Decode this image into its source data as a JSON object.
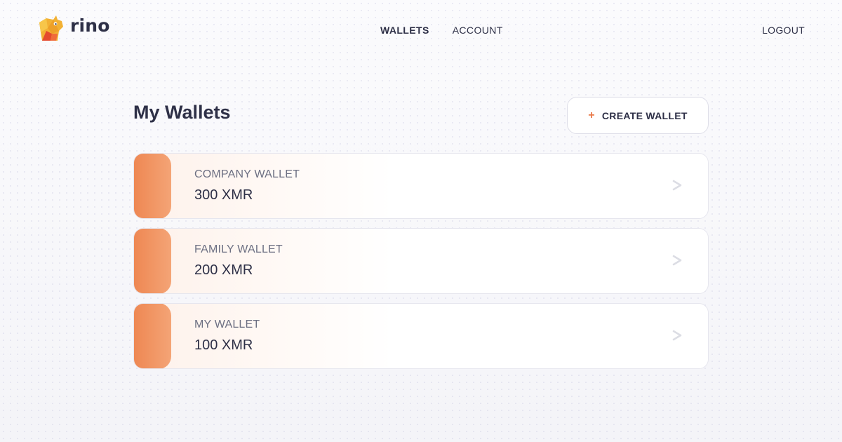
{
  "brand": {
    "name": "rino"
  },
  "nav": {
    "items": [
      {
        "label": "WALLETS",
        "active": true
      },
      {
        "label": "ACCOUNT",
        "active": false
      }
    ],
    "logout_label": "LOGOUT"
  },
  "main": {
    "title": "My Wallets",
    "create_button": {
      "icon": "+",
      "label": "CREATE WALLET"
    },
    "wallets": [
      {
        "name": "COMPANY WALLET",
        "balance": "300 XMR"
      },
      {
        "name": "FAMILY WALLET",
        "balance": "200 XMR"
      },
      {
        "name": "MY WALLET",
        "balance": "100 XMR"
      }
    ]
  },
  "colors": {
    "accent": "#ee8752",
    "text": "#2e3047",
    "muted": "#6c6f82"
  },
  "icons": [
    "rino-logo-icon",
    "plus-icon",
    "chevron-right-icon"
  ]
}
